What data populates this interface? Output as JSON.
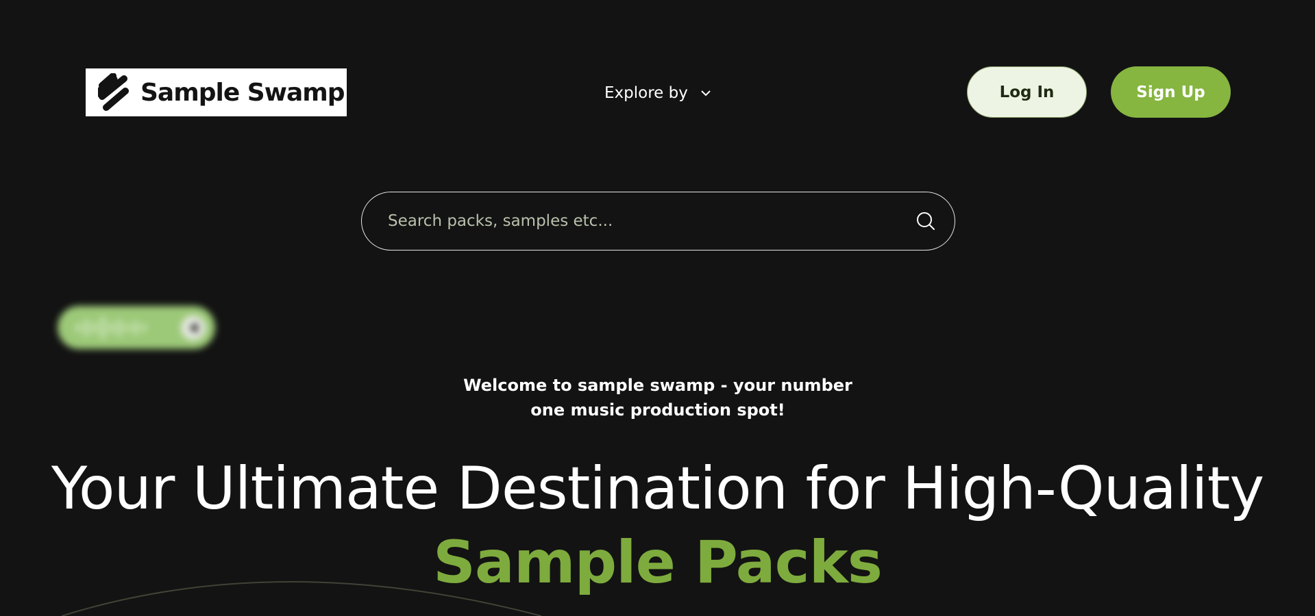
{
  "header": {
    "logo_text": "Sample Swamp",
    "explore_label": "Explore by",
    "login_label": "Log In",
    "signup_label": "Sign Up"
  },
  "search": {
    "placeholder": "Search packs, samples etc..."
  },
  "hero": {
    "welcome": "Welcome to sample swamp - your number one music production spot!",
    "headline_part1": "Your Ultimate Destination for High-Quality ",
    "headline_accent": "Sample Packs"
  },
  "colors": {
    "background": "#131313",
    "accent": "#86b540",
    "login_bg": "#eef4e4"
  },
  "icons": {
    "logo": "sample-swamp-logo-icon",
    "explore": "chevron-down-icon",
    "search": "search-icon",
    "player_wave": "waveform-icon",
    "player_play": "play-icon"
  }
}
